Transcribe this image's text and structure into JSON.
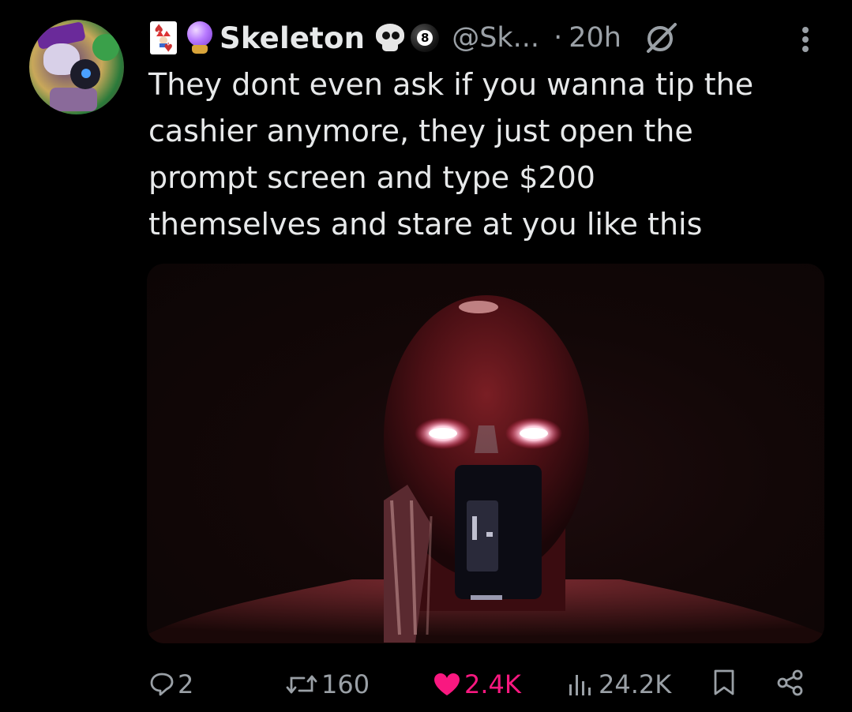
{
  "post": {
    "display_name": "Skeleton",
    "handle": "@Sk...",
    "separator": "·",
    "time": "20h",
    "text_lines": [
      "They dont even ask if you wanna tip the",
      "cashier anymore, they just open the",
      "prompt screen and type $200",
      "themselves and stare at you like this"
    ],
    "badges": {
      "eight_ball_label": "8",
      "icons": [
        "joker-card-icon",
        "crystal-ball-icon",
        "skull-icon",
        "eight-ball-icon"
      ]
    },
    "media_alt_icon": "media-image"
  },
  "actions": {
    "replies": "2",
    "reposts": "160",
    "likes": "2.4K",
    "views": "24.2K",
    "icons": [
      "reply-icon",
      "repost-icon",
      "like-icon",
      "views-icon",
      "bookmark-icon",
      "share-icon"
    ]
  },
  "colors": {
    "background": "#000000",
    "text": "#e7e9ea",
    "secondary": "#9aa0a6",
    "like_accent": "#f91880"
  }
}
